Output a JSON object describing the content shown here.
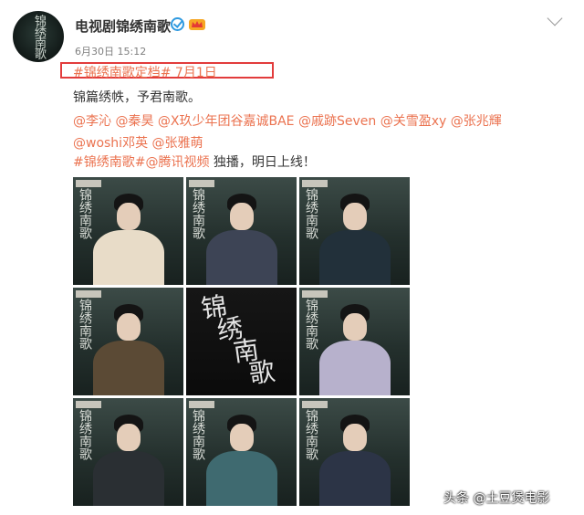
{
  "post": {
    "account_name": "电视剧锦绣南歌",
    "timestamp": "6月30日 15:12",
    "avatar_mark": "锦绣南歌",
    "line1_text": "#锦绣南歌定档# 7月1日",
    "line2": "锦篇绣帙，予君南歌。",
    "mentions_line3": [
      "@李沁",
      "@秦昊",
      "@X玖少年团谷嘉诚BAE",
      "@戚跡Seven",
      "@关雪盈xy",
      "@张兆輝"
    ],
    "mentions_line4": [
      "@woshi邓英",
      "@张雅萌"
    ],
    "line5_tag": "#锦绣南歌#",
    "line5_mention": "@腾讯视频",
    "line5_rest": " 独播，明日上线！",
    "highlight_color": "#e23c3c",
    "link_color": "#eb7350"
  },
  "grid": {
    "center_title": "锦绣南歌",
    "poster_mark": "锦绣南歌"
  },
  "watermark": "头条 @土豆煲电影"
}
